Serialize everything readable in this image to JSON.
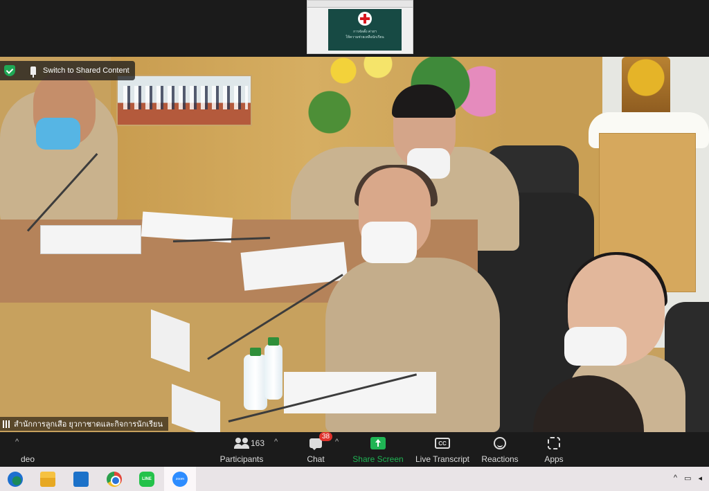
{
  "share_banner": {
    "label": "Switch to Shared Content"
  },
  "video": {
    "participant_name": "สำนักการลูกเสือ ยุวกาชาดและกิจการนักเรียน",
    "slide_text_line1": "การจัดตั้ง ค่ายฯ",
    "slide_text_line2": "ให้ความช่วยเหลือนักเรียน"
  },
  "toolbar": {
    "video_label": "deo",
    "participants_label": "Participants",
    "participants_count": "163",
    "chat_label": "Chat",
    "chat_badge": "38",
    "share_label": "Share Screen",
    "transcript_label": "Live Transcript",
    "transcript_icon": "CC",
    "reactions_label": "Reactions",
    "apps_label": "Apps",
    "share_color": "#1fb454"
  },
  "taskbar": {
    "apps": [
      "edge-icon",
      "file-explorer-icon",
      "mail-icon",
      "chrome-icon",
      "line-icon",
      "zoom-icon"
    ],
    "line_text": "LINE",
    "zoom_text": "zoom"
  }
}
